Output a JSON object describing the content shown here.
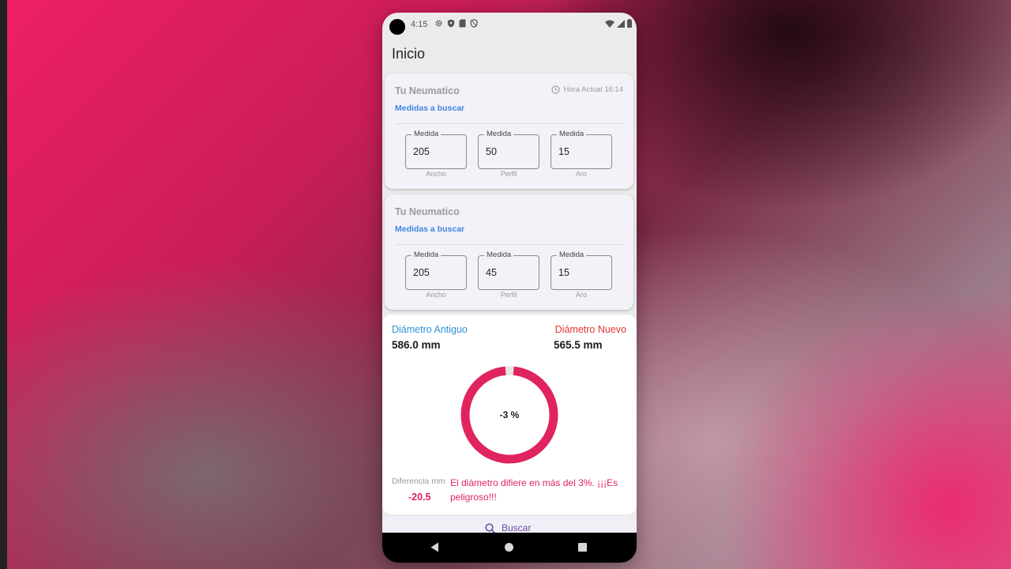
{
  "status_bar": {
    "time": "4:15",
    "icons": [
      "gear-icon",
      "shield-icon",
      "sd-card-icon",
      "vpn-icon",
      "wifi-icon",
      "signal-icon",
      "battery-icon"
    ]
  },
  "app_bar": {
    "title": "Inicio"
  },
  "cards": [
    {
      "title": "Tu Neumatico",
      "time_label": "Hora Actual 16:14",
      "subtitle": "Medidas a buscar",
      "fields": [
        {
          "label": "Medida",
          "value": "205",
          "helper": "Ancho"
        },
        {
          "label": "Medida",
          "value": "50",
          "helper": "Perfil"
        },
        {
          "label": "Medida",
          "value": "15",
          "helper": "Aro"
        }
      ]
    },
    {
      "title": "Tu Neumatico",
      "subtitle": "Medidas a buscar",
      "fields": [
        {
          "label": "Medida",
          "value": "205",
          "helper": "Ancho"
        },
        {
          "label": "Medida",
          "value": "45",
          "helper": "Perfil"
        },
        {
          "label": "Medida",
          "value": "15",
          "helper": "Aro"
        }
      ]
    }
  ],
  "result": {
    "old_label": "Diámetro Antiguo",
    "old_value": "586.0 mm",
    "new_label": "Diámetro Nuevo",
    "new_value": "565.5 mm",
    "percent_label": "-3 %",
    "gauge_fraction": 0.97,
    "diff_label": "Diferencia mm",
    "diff_value": "-20.5",
    "warning": "El diámetro difiere en más del 3%. ¡¡¡Es peligroso!!!"
  },
  "bottom": {
    "search_label": "Buscar"
  },
  "colors": {
    "accent": "#e0245e",
    "old_color": "#2d93d8",
    "new_color": "#e5342f",
    "link_color": "#3f86e0",
    "gauge_track": "#e6e6e6"
  }
}
